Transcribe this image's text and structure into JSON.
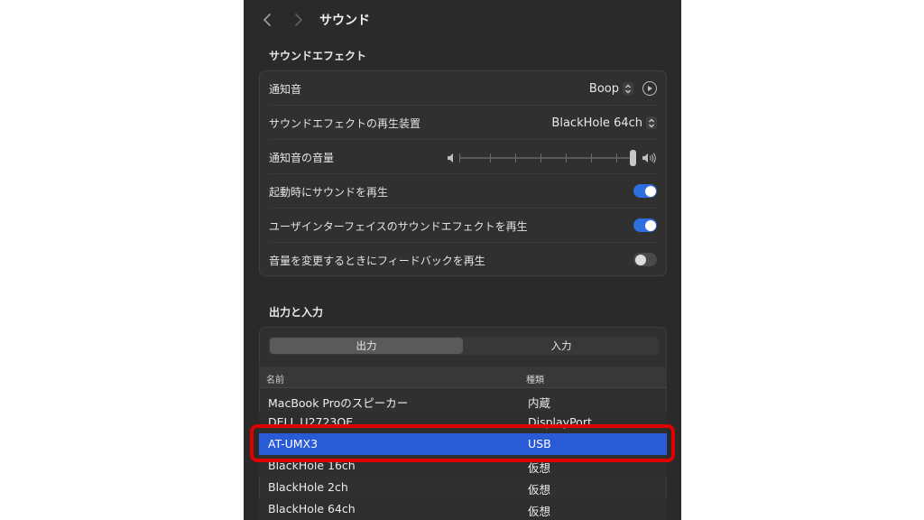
{
  "window": {
    "title": "サウンド"
  },
  "sound_effects": {
    "section_title": "サウンドエフェクト",
    "alert_sound": {
      "label": "通知音",
      "value": "Boop"
    },
    "output_device": {
      "label": "サウンドエフェクトの再生装置",
      "value": "BlackHole 64ch"
    },
    "alert_volume": {
      "label": "通知音の音量",
      "level": 1.0
    },
    "startup_sound": {
      "label": "起動時にサウンドを再生",
      "on": true
    },
    "ui_sound_effects": {
      "label": "ユーザインターフェイスのサウンドエフェクトを再生",
      "on": true
    },
    "volume_feedback": {
      "label": "音量を変更するときにフィードバックを再生",
      "on": false
    }
  },
  "output_input": {
    "section_title": "出力と入力",
    "tabs": [
      {
        "label": "出力",
        "active": true
      },
      {
        "label": "入力",
        "active": false
      }
    ],
    "columns": {
      "name": "名前",
      "type": "種類"
    },
    "devices": [
      {
        "name": "MacBook Proのスピーカー",
        "type": "内蔵"
      },
      {
        "name": "DELL U2723QE",
        "type": "DisplayPort"
      },
      {
        "name": "AT-UMX3",
        "type": "USB",
        "selected": true
      },
      {
        "name": "BlackHole 16ch",
        "type": "仮想"
      },
      {
        "name": "BlackHole 2ch",
        "type": "仮想"
      },
      {
        "name": "BlackHole 64ch",
        "type": "仮想"
      }
    ]
  },
  "colors": {
    "accent": "#2a5bd7",
    "annotation": "#e00000"
  }
}
